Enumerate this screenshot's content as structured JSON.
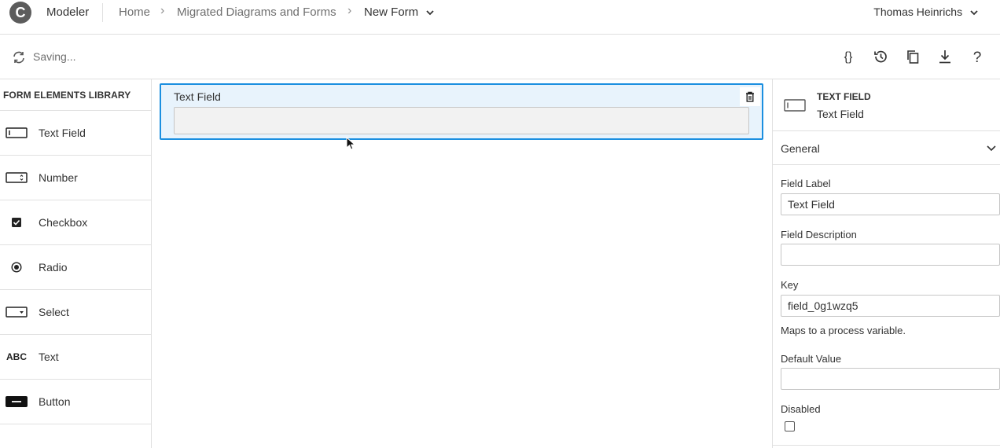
{
  "header": {
    "logo_letter": "C",
    "app_name": "Modeler",
    "breadcrumbs": [
      "Home",
      "Migrated Diagrams and Forms"
    ],
    "breadcrumb_sep": "›",
    "current": "New Form",
    "user_name": "Thomas Heinrichs"
  },
  "toolbar": {
    "status": "Saving...",
    "buttons": [
      "json-icon",
      "history-icon",
      "copy-icon",
      "download-icon",
      "help-icon"
    ]
  },
  "library": {
    "title": "FORM ELEMENTS LIBRARY",
    "items": [
      {
        "label": "Text Field",
        "icon": "textfield-icon"
      },
      {
        "label": "Number",
        "icon": "number-icon"
      },
      {
        "label": "Checkbox",
        "icon": "checkbox-icon"
      },
      {
        "label": "Radio",
        "icon": "radio-icon"
      },
      {
        "label": "Select",
        "icon": "select-icon"
      },
      {
        "label": "Text",
        "icon": "text-icon",
        "icon_text": "ABC"
      },
      {
        "label": "Button",
        "icon": "button-icon"
      }
    ]
  },
  "canvas": {
    "field": {
      "label": "Text Field"
    }
  },
  "properties": {
    "type": "TEXT FIELD",
    "name": "Text Field",
    "group": "General",
    "field_label": {
      "label": "Field Label",
      "value": "Text Field"
    },
    "field_description": {
      "label": "Field Description",
      "value": ""
    },
    "key": {
      "label": "Key",
      "value": "field_0g1wzq5",
      "hint": "Maps to a process variable."
    },
    "default_value": {
      "label": "Default Value",
      "value": ""
    },
    "disabled": {
      "label": "Disabled",
      "checked": false
    }
  },
  "colors": {
    "accent": "#1b8fe0",
    "selected_bg": "#e8f3fc"
  }
}
